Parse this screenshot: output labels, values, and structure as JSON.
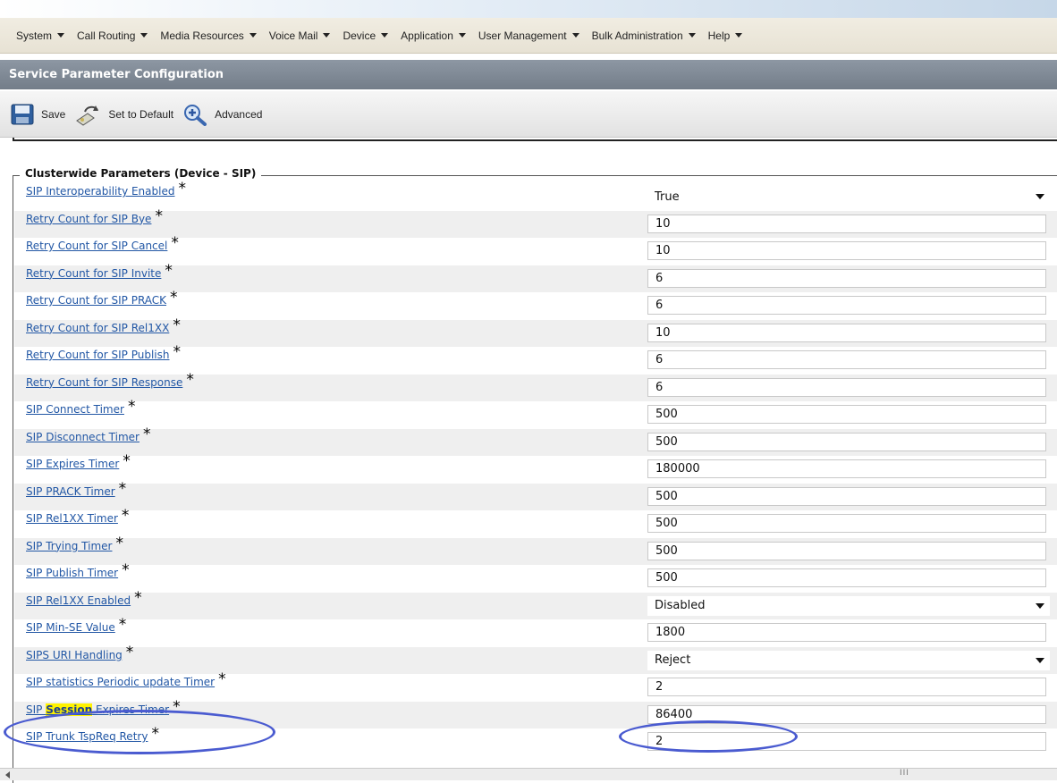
{
  "menu": [
    {
      "label": "System"
    },
    {
      "label": "Call Routing"
    },
    {
      "label": "Media Resources"
    },
    {
      "label": "Voice Mail"
    },
    {
      "label": "Device"
    },
    {
      "label": "Application"
    },
    {
      "label": "User Management"
    },
    {
      "label": "Bulk Administration"
    },
    {
      "label": "Help"
    }
  ],
  "page_title": "Service Parameter Configuration",
  "toolbar": {
    "save_label": "Save",
    "default_label": "Set to Default",
    "advanced_label": "Advanced"
  },
  "section_title": "Clusterwide Parameters (Device - SIP)",
  "required_mark": "*",
  "params": [
    {
      "label": "SIP Interoperability Enabled",
      "value": "True",
      "control": "select"
    },
    {
      "label": "Retry Count for SIP Bye",
      "value": "10",
      "control": "text"
    },
    {
      "label": "Retry Count for SIP Cancel",
      "value": "10",
      "control": "text"
    },
    {
      "label": "Retry Count for SIP Invite",
      "value": "6",
      "control": "text"
    },
    {
      "label": "Retry Count for SIP PRACK",
      "value": "6",
      "control": "text"
    },
    {
      "label": "Retry Count for SIP Rel1XX",
      "value": "10",
      "control": "text"
    },
    {
      "label": "Retry Count for SIP Publish",
      "value": "6",
      "control": "text"
    },
    {
      "label": "Retry Count for SIP Response",
      "value": "6",
      "control": "text"
    },
    {
      "label": "SIP Connect Timer",
      "value": "500",
      "control": "text"
    },
    {
      "label": "SIP Disconnect Timer",
      "value": "500",
      "control": "text"
    },
    {
      "label": "SIP Expires Timer",
      "value": "180000",
      "control": "text"
    },
    {
      "label": "SIP PRACK Timer",
      "value": "500",
      "control": "text"
    },
    {
      "label": "SIP Rel1XX Timer",
      "value": "500",
      "control": "text"
    },
    {
      "label": "SIP Trying Timer",
      "value": "500",
      "control": "text"
    },
    {
      "label": "SIP Publish Timer",
      "value": "500",
      "control": "text"
    },
    {
      "label": "SIP Rel1XX Enabled",
      "value": "Disabled",
      "control": "select"
    },
    {
      "label": "SIP Min-SE Value",
      "value": "1800",
      "control": "text"
    },
    {
      "label": "SIPS URI Handling",
      "value": "Reject",
      "control": "select"
    },
    {
      "label": "SIP statistics Periodic update Timer",
      "value": "2",
      "control": "text"
    },
    {
      "label_before": "SIP ",
      "label_highlight": "Session",
      "label_after": " Expires Timer",
      "value": "86400",
      "control": "text",
      "annotated": true
    },
    {
      "label": "SIP Trunk TspReq Retry",
      "value": "2",
      "control": "text"
    }
  ],
  "scrollbar_grip": "III",
  "colors": {
    "title_bar": "#7d8794",
    "link": "#2257a5",
    "highlight": "#fff200",
    "annotation_oval": "#4a5bd0"
  }
}
